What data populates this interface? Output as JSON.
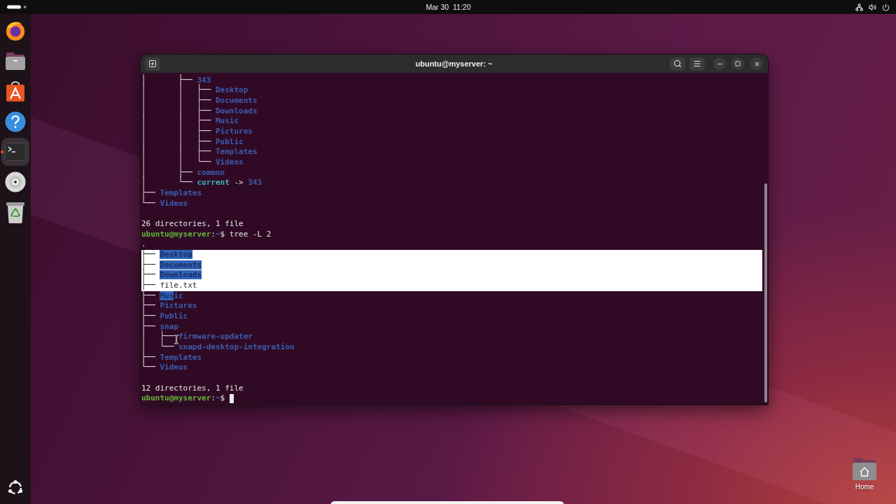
{
  "top_bar": {
    "clock": "Mar 30  11:20"
  },
  "dock": {
    "apps": [
      {
        "kind": "browser",
        "active": false
      },
      {
        "kind": "files",
        "active": false
      },
      {
        "kind": "store",
        "active": false
      },
      {
        "kind": "help",
        "active": false
      },
      {
        "kind": "terminal",
        "active": true
      },
      {
        "kind": "disc",
        "active": false
      },
      {
        "kind": "trash",
        "active": false
      }
    ]
  },
  "window": {
    "title": "ubuntu@myserver: ~"
  },
  "terminal": {
    "lines": [
      {
        "kind": "tree",
        "branch": "│       ├──",
        "highlighted": false,
        "parts": [
          {
            "kind": "dir",
            "text": "343",
            "selected": false
          }
        ]
      },
      {
        "kind": "tree",
        "branch": "│       │   ├──",
        "highlighted": false,
        "parts": [
          {
            "kind": "dir",
            "text": "Desktop",
            "selected": false
          }
        ]
      },
      {
        "kind": "tree",
        "branch": "│       │   ├──",
        "highlighted": false,
        "parts": [
          {
            "kind": "dir",
            "text": "Documents",
            "selected": false
          }
        ]
      },
      {
        "kind": "tree",
        "branch": "│       │   ├──",
        "highlighted": false,
        "parts": [
          {
            "kind": "dir",
            "text": "Downloads",
            "selected": false
          }
        ]
      },
      {
        "kind": "tree",
        "branch": "│       │   ├──",
        "highlighted": false,
        "parts": [
          {
            "kind": "dir",
            "text": "Music",
            "selected": false
          }
        ]
      },
      {
        "kind": "tree",
        "branch": "│       │   ├──",
        "highlighted": false,
        "parts": [
          {
            "kind": "dir",
            "text": "Pictures",
            "selected": false
          }
        ]
      },
      {
        "kind": "tree",
        "branch": "│       │   ├──",
        "highlighted": false,
        "parts": [
          {
            "kind": "dir",
            "text": "Public",
            "selected": false
          }
        ]
      },
      {
        "kind": "tree",
        "branch": "│       │   ├──",
        "highlighted": false,
        "parts": [
          {
            "kind": "dir",
            "text": "Templates",
            "selected": false
          }
        ]
      },
      {
        "kind": "tree",
        "branch": "│       │   └──",
        "highlighted": false,
        "parts": [
          {
            "kind": "dir",
            "text": "Videos",
            "selected": false
          }
        ]
      },
      {
        "kind": "tree",
        "branch": "│       ├──",
        "highlighted": false,
        "parts": [
          {
            "kind": "dir",
            "text": "common",
            "selected": false
          }
        ]
      },
      {
        "kind": "tree",
        "branch": "│       └──",
        "highlighted": false,
        "parts": [
          {
            "kind": "link",
            "text": "current",
            "selected": false
          },
          {
            "kind": "plain",
            "text": " -> ",
            "selected": false
          },
          {
            "kind": "dir",
            "text": "343",
            "selected": false
          }
        ]
      },
      {
        "kind": "tree",
        "branch": "├──",
        "highlighted": false,
        "parts": [
          {
            "kind": "dir",
            "text": "Templates",
            "selected": false
          }
        ]
      },
      {
        "kind": "tree",
        "branch": "└──",
        "highlighted": false,
        "parts": [
          {
            "kind": "dir",
            "text": "Videos",
            "selected": false
          }
        ]
      },
      {
        "kind": "blank"
      },
      {
        "kind": "summary",
        "text": "26 directories, 1 file"
      },
      {
        "kind": "prompt",
        "user": "ubuntu@myserver",
        "colon": ":",
        "path": "~",
        "symbol": "$",
        "command": "tree -L 2"
      },
      {
        "kind": "plain",
        "text": "."
      },
      {
        "kind": "tree",
        "branch": "├──",
        "highlighted": true,
        "parts": [
          {
            "kind": "dir",
            "text": "Desktop",
            "selected": true
          }
        ]
      },
      {
        "kind": "tree",
        "branch": "├──",
        "highlighted": true,
        "parts": [
          {
            "kind": "dir",
            "text": "Documents",
            "selected": true
          }
        ]
      },
      {
        "kind": "tree",
        "branch": "├──",
        "highlighted": true,
        "parts": [
          {
            "kind": "dir",
            "text": "Downloads",
            "selected": true
          }
        ]
      },
      {
        "kind": "tree",
        "branch": "├──",
        "highlighted": true,
        "parts": [
          {
            "kind": "file",
            "text": "file.txt",
            "selected": false
          }
        ]
      },
      {
        "kind": "tree",
        "branch": "├──",
        "highlighted": false,
        "parts": [
          {
            "kind": "dir",
            "text": "Mus",
            "selected": true
          },
          {
            "kind": "dir",
            "text": "ic",
            "selected": false
          }
        ]
      },
      {
        "kind": "tree",
        "branch": "├──",
        "highlighted": false,
        "parts": [
          {
            "kind": "dir",
            "text": "Pictures",
            "selected": false
          }
        ]
      },
      {
        "kind": "tree",
        "branch": "├──",
        "highlighted": false,
        "parts": [
          {
            "kind": "dir",
            "text": "Public",
            "selected": false
          }
        ]
      },
      {
        "kind": "tree",
        "branch": "├──",
        "highlighted": false,
        "parts": [
          {
            "kind": "dir",
            "text": "snap",
            "selected": false
          }
        ]
      },
      {
        "kind": "tree",
        "branch": "│   ├──",
        "highlighted": false,
        "parts": [
          {
            "kind": "dir",
            "text": "firmware-updater",
            "selected": false
          }
        ]
      },
      {
        "kind": "tree",
        "branch": "│   └──",
        "highlighted": false,
        "parts": [
          {
            "kind": "dir",
            "text": "snapd-desktop-integration",
            "selected": false
          }
        ]
      },
      {
        "kind": "tree",
        "branch": "├──",
        "highlighted": false,
        "parts": [
          {
            "kind": "dir",
            "text": "Templates",
            "selected": false
          }
        ]
      },
      {
        "kind": "tree",
        "branch": "└──",
        "highlighted": false,
        "parts": [
          {
            "kind": "dir",
            "text": "Videos",
            "selected": false
          }
        ]
      },
      {
        "kind": "blank"
      },
      {
        "kind": "summary",
        "text": "12 directories, 1 file"
      },
      {
        "kind": "prompt",
        "user": "ubuntu@myserver",
        "colon": ":",
        "path": "~",
        "symbol": "$",
        "cursor": true
      }
    ]
  },
  "desktop_icons": [
    {
      "kind": "home",
      "label": "Home"
    }
  ]
}
